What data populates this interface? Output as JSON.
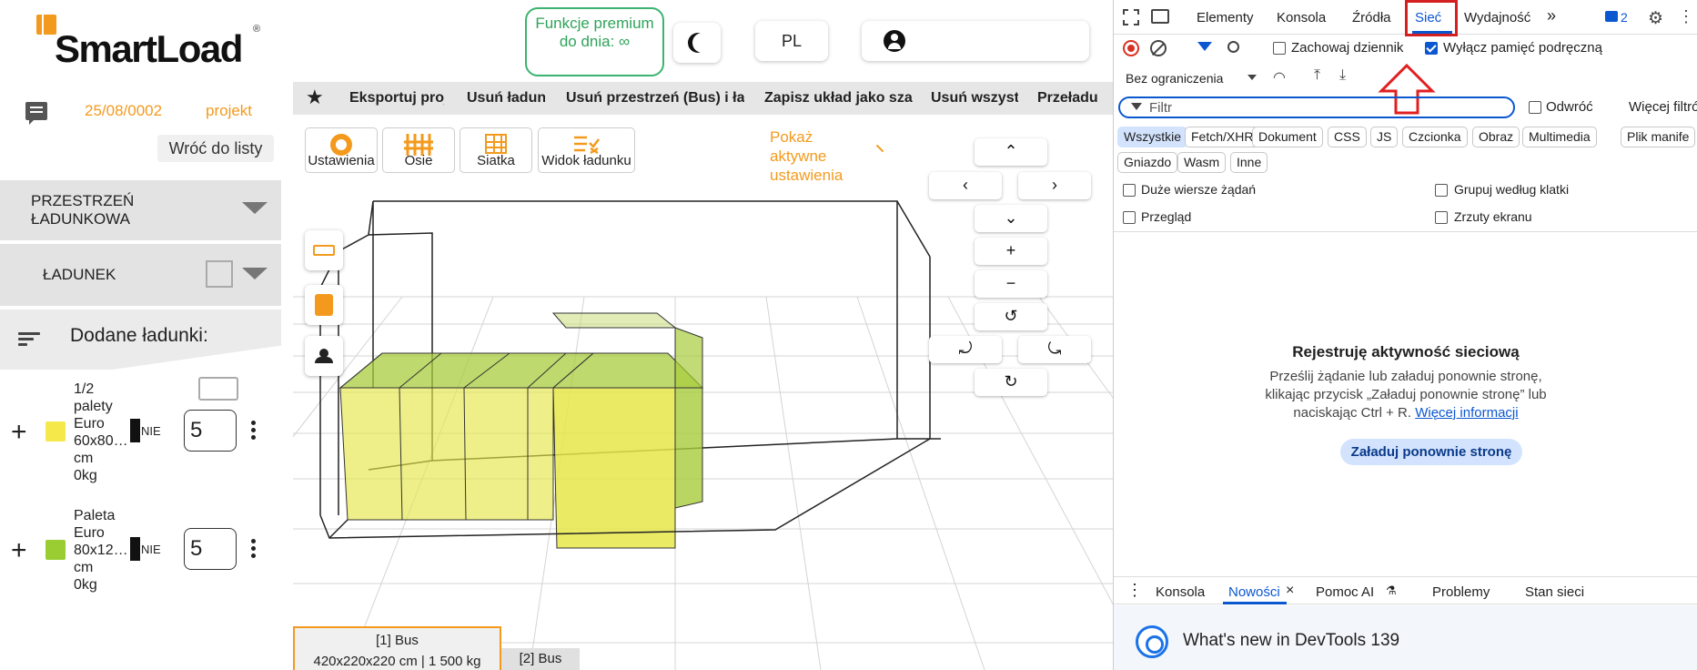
{
  "app": {
    "logo": "SmartLoad",
    "logo_mark": "®",
    "date": "25/08/0002",
    "project": "projekt",
    "back_label": "Wróć do listy",
    "accordion_space": "PRZESTRZEŃ\nŁADUNKOWA",
    "accordion_cargo": "ŁADUNEK",
    "added_label": "Dodane ładunki:",
    "items": [
      {
        "name": "1/2\npalety\nEuro\n60x80…\ncm\n0kg",
        "color": "#f5e84a",
        "flag": "NIE",
        "qty": "5"
      },
      {
        "name": "Paleta\nEuro\n80x12…\ncm\n0kg",
        "color": "#9acd32",
        "flag": "NIE",
        "qty": "5"
      }
    ],
    "premium": "Funkcje premium do dnia: ∞",
    "lang": "PL",
    "toolbar": [
      "Eksportuj proj",
      "Usuń ładun",
      "Usuń przestrzeń (Bus) i ład",
      "Zapisz układ jako sza",
      "Usuń wszyst",
      "Przeładu"
    ],
    "tools": [
      "Ustawienia",
      "Osie",
      "Siatka",
      "Widok ładunku"
    ],
    "show_settings": "Pokaż\naktywne\nustawienia",
    "nav": {
      "up": "⌃",
      "left": "‹",
      "right": "›",
      "down": "⌄",
      "zoom_in": "+",
      "zoom_out": "−",
      "rot": "↺",
      "rot_l": "⤾",
      "rot_r": "⤿",
      "rot_b": "↻"
    },
    "bus_tabs": [
      {
        "line1": "[1] Bus",
        "line2": "420x220x220 cm | 1 500 kg"
      },
      {
        "line1": "[2] Bus"
      }
    ],
    "colors": {
      "accent": "#f39a1e",
      "premium": "#2fa35a",
      "box_yellow": "#e6e64a",
      "box_green": "#a5cf3a"
    }
  },
  "devtools": {
    "tabs": [
      "Elementy",
      "Konsola",
      "Źródła",
      "Sieć",
      "Wydajność"
    ],
    "selected_tab": "Sieć",
    "more": "»",
    "issues_count": "2",
    "preserve_log": "Zachowaj dziennik",
    "disable_cache": "Wyłącz pamięć podręczną",
    "throttle": "Bez ograniczenia",
    "filter_placeholder": "Filtr",
    "invert": "Odwróć",
    "more_filters": "Więcej filtrów",
    "pills_row1": [
      "Wszystkie",
      "Fetch/XHR",
      "Dokument",
      "CSS",
      "JS",
      "Czcionka",
      "Obraz",
      "Multimedia",
      "Plik manife"
    ],
    "pills_row2": [
      "Gniazdo",
      "Wasm",
      "Inne"
    ],
    "options": [
      "Duże wiersze żądań",
      "Grupuj według klatki",
      "Przegląd",
      "Zrzuty ekranu"
    ],
    "empty_title": "Rejestruję aktywność sieciową",
    "empty_line1": "Prześlij żądanie lub załaduj ponownie stronę,",
    "empty_line2": "klikając przycisk „Załaduj ponownie stronę” lub",
    "empty_line3_a": "naciskając Ctrl + R. ",
    "empty_link": "Więcej informacji",
    "reload": "Załaduj ponownie stronę",
    "drawer_tabs": [
      "Konsola",
      "Nowości",
      "Pomoc AI",
      "Problemy",
      "Stan sieci"
    ],
    "news_title": "What's new in DevTools 139",
    "highlight_color": "#d42020"
  }
}
